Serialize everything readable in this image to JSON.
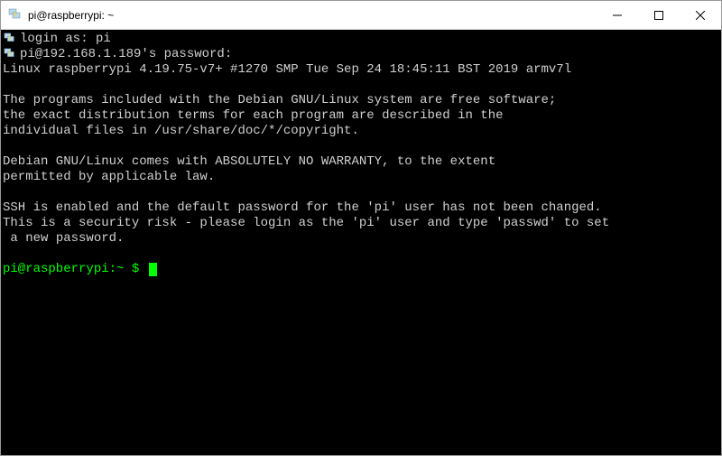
{
  "window": {
    "title": "pi@raspberrypi: ~"
  },
  "session": {
    "login_label": "login as:",
    "login_user": "pi",
    "password_prompt": "pi@192.168.1.189's password:"
  },
  "motd": {
    "kernel": "Linux raspberrypi 4.19.75-v7+ #1270 SMP Tue Sep 24 18:45:11 BST 2019 armv7l",
    "l1": "The programs included with the Debian GNU/Linux system are free software;",
    "l2": "the exact distribution terms for each program are described in the",
    "l3": "individual files in /usr/share/doc/*/copyright.",
    "l4": "Debian GNU/Linux comes with ABSOLUTELY NO WARRANTY, to the extent",
    "l5": "permitted by applicable law.",
    "w1": "SSH is enabled and the default password for the 'pi' user has not been changed.",
    "w2": "This is a security risk - please login as the 'pi' user and type 'passwd' to set",
    "w3": " a new password."
  },
  "prompt": {
    "user_host": "pi@raspberrypi",
    "colon": ":",
    "cwd": "~",
    "sigil": " $ "
  }
}
